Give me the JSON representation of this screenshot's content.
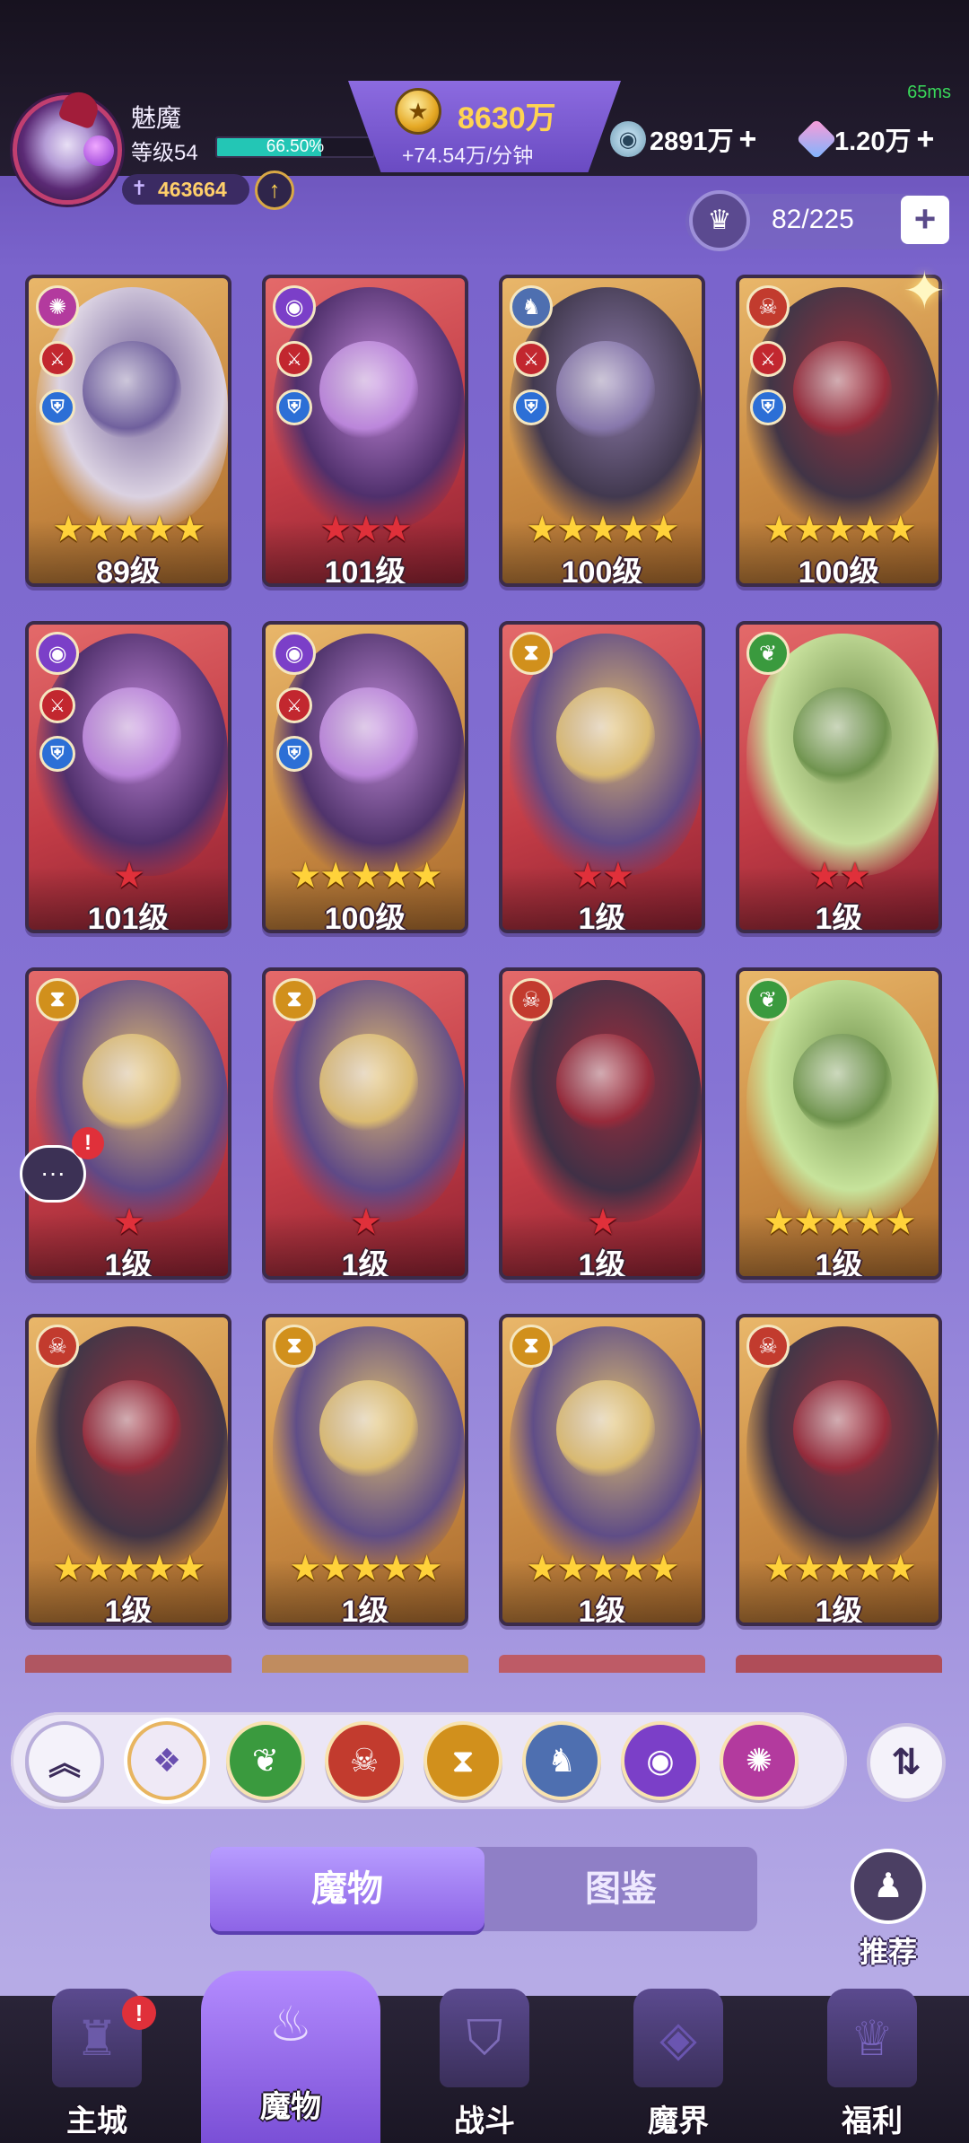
{
  "header": {
    "ping": "65ms",
    "player_name": "魅魔",
    "level_label": "等级54",
    "xp_percent": "66.50%",
    "xp_fraction": 0.665,
    "power": "463664",
    "gold": "8630万",
    "gold_rate": "+74.54万/分钟",
    "resource1": "2891万",
    "resource2": "1.20万",
    "plus": "+"
  },
  "capacity": {
    "value": "82/225",
    "plus": "+"
  },
  "cards": [
    {
      "level": "89级",
      "stars": 5,
      "star_color": "gold",
      "frame": "gold",
      "faction": "chaos",
      "role_badges": true
    },
    {
      "level": "101级",
      "stars": 3,
      "star_color": "red",
      "frame": "red",
      "faction": "eye",
      "role_badges": true
    },
    {
      "level": "100级",
      "stars": 5,
      "star_color": "gold",
      "frame": "gold",
      "faction": "dragon",
      "role_badges": true
    },
    {
      "level": "100级",
      "stars": 5,
      "star_color": "gold",
      "frame": "gold",
      "faction": "demon",
      "role_badges": true
    },
    {
      "level": "101级",
      "stars": 1,
      "star_color": "red",
      "frame": "red",
      "faction": "eye",
      "role_badges": true
    },
    {
      "level": "100级",
      "stars": 5,
      "star_color": "gold",
      "frame": "gold",
      "faction": "eye",
      "role_badges": true
    },
    {
      "level": "1级",
      "stars": 2,
      "star_color": "red",
      "frame": "red",
      "faction": "time",
      "role_badges": false
    },
    {
      "level": "1级",
      "stars": 2,
      "star_color": "red",
      "frame": "red",
      "faction": "nature",
      "role_badges": false
    },
    {
      "level": "1级",
      "stars": 1,
      "star_color": "red",
      "frame": "red",
      "faction": "time",
      "role_badges": false
    },
    {
      "level": "1级",
      "stars": 1,
      "star_color": "red",
      "frame": "red",
      "faction": "time",
      "role_badges": false
    },
    {
      "level": "1级",
      "stars": 1,
      "star_color": "red",
      "frame": "red",
      "faction": "demon",
      "role_badges": false
    },
    {
      "level": "1级",
      "stars": 5,
      "star_color": "gold",
      "frame": "gold",
      "faction": "nature",
      "role_badges": false
    },
    {
      "level": "1级",
      "stars": 5,
      "star_color": "gold",
      "frame": "gold",
      "faction": "demon",
      "role_badges": false
    },
    {
      "level": "1级",
      "stars": 5,
      "star_color": "gold",
      "frame": "gold",
      "faction": "time",
      "role_badges": false
    },
    {
      "level": "1级",
      "stars": 5,
      "star_color": "gold",
      "frame": "gold",
      "faction": "time",
      "role_badges": false
    },
    {
      "level": "1级",
      "stars": 5,
      "star_color": "gold",
      "frame": "gold",
      "faction": "demon",
      "role_badges": false
    }
  ],
  "filters": [
    {
      "name": "collapse",
      "icon": "double-chevron-up-icon"
    },
    {
      "name": "all",
      "icon": "diamond-grid-icon"
    },
    {
      "name": "nature",
      "icon": "leaf-icon"
    },
    {
      "name": "demon",
      "icon": "demon-mask-icon"
    },
    {
      "name": "time",
      "icon": "hourglass-icon"
    },
    {
      "name": "dragon",
      "icon": "dragon-icon"
    },
    {
      "name": "eye",
      "icon": "eye-icon"
    },
    {
      "name": "chaos",
      "icon": "swirl-icon"
    }
  ],
  "tabs": {
    "monsters": "魔物",
    "codex": "图鉴"
  },
  "recommend": "推荐",
  "nav": [
    {
      "label": "主城",
      "icon": "castle-icon"
    },
    {
      "label": "魔物",
      "icon": "flame-icon"
    },
    {
      "label": "战斗",
      "icon": "shield-sword-icon"
    },
    {
      "label": "魔界",
      "icon": "portal-icon"
    },
    {
      "label": "福利",
      "icon": "chest-icon"
    }
  ],
  "colors": {
    "accent": "#8d64e6",
    "gold_text": "#ffd451",
    "star_gold": "#ffd23a",
    "star_red": "#e0303a",
    "frame_gold": "#c98a42",
    "frame_red": "#c23c46"
  }
}
